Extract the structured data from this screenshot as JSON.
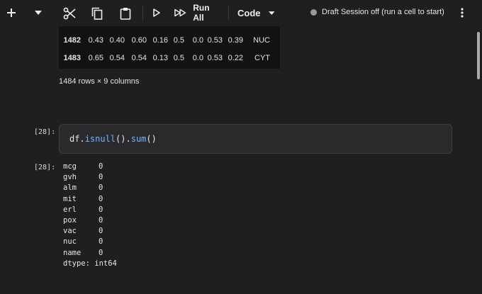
{
  "toolbar": {
    "run_all_label": "Run All",
    "cell_type": "Code",
    "session_status": "Draft Session off (run a cell to start)"
  },
  "dataframe": {
    "rows": [
      {
        "index": "1482",
        "cells": [
          "0.43",
          "0.40",
          "0.60",
          "0.16",
          "0.5",
          "0.0",
          "0.53",
          "0.39",
          "NUC"
        ]
      },
      {
        "index": "1483",
        "cells": [
          "0.65",
          "0.54",
          "0.54",
          "0.13",
          "0.5",
          "0.0",
          "0.53",
          "0.22",
          "CYT"
        ]
      }
    ],
    "shape_text": "1484 rows × 9 columns"
  },
  "cell": {
    "input_prompt": "[28]:",
    "output_prompt": "[28]:",
    "code": {
      "obj": "df.",
      "fn1": "isnull",
      "mid": "().",
      "fn2": "sum",
      "end": "()"
    },
    "output_lines": [
      {
        "key": "mcg",
        "value": "0"
      },
      {
        "key": "gvh",
        "value": "0"
      },
      {
        "key": "alm",
        "value": "0"
      },
      {
        "key": "mit",
        "value": "0"
      },
      {
        "key": "erl",
        "value": "0"
      },
      {
        "key": "pox",
        "value": "0"
      },
      {
        "key": "vac",
        "value": "0"
      },
      {
        "key": "nuc",
        "value": "0"
      },
      {
        "key": "name",
        "value": "0"
      }
    ],
    "dtype_line": "dtype: int64"
  },
  "icons": [
    "add-icon",
    "chevron-down-icon",
    "cut-icon",
    "copy-icon",
    "paste-icon",
    "run-icon",
    "run-all-icon",
    "more-vert-icon"
  ],
  "colors": {
    "background": "#1f1f21",
    "table_bg": "#121214",
    "function": "#6cb6ff",
    "status_dot": "#9b9b9b"
  }
}
